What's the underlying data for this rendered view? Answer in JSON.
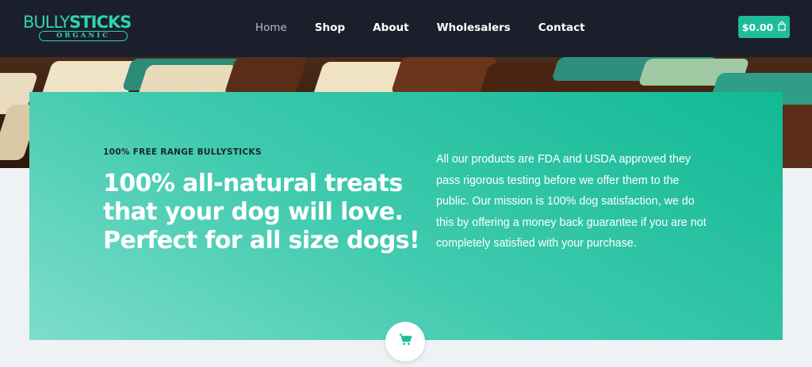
{
  "brand": {
    "logo_word_a": "BULLY",
    "logo_word_b": "STICKS",
    "logo_sub": "ORGANIC",
    "accent_color": "#2fd3b3"
  },
  "nav": {
    "items": [
      {
        "label": "Home",
        "active": true
      },
      {
        "label": "Shop",
        "active": false
      },
      {
        "label": "About",
        "active": false
      },
      {
        "label": "Wholesalers",
        "active": false
      },
      {
        "label": "Contact",
        "active": false
      }
    ]
  },
  "cart": {
    "total": "$0.00",
    "icon": "shopping-bag-icon",
    "button_color": "#1ebc98"
  },
  "hero": {
    "eyebrow": "100% FREE RANGE BULLYSTICKS",
    "headline": "100% all-natural treats that your dog will love. Perfect for all size dogs!",
    "body": "All our products are FDA and USDA approved they pass rigorous testing before we offer them to the public. Our mission is 100% dog satisfaction, we do this by offering a money back guarantee if you are not completely satisfied with your purchase.",
    "panel_color": "#11b994"
  },
  "floating_cart": {
    "icon": "shopping-cart-icon"
  }
}
